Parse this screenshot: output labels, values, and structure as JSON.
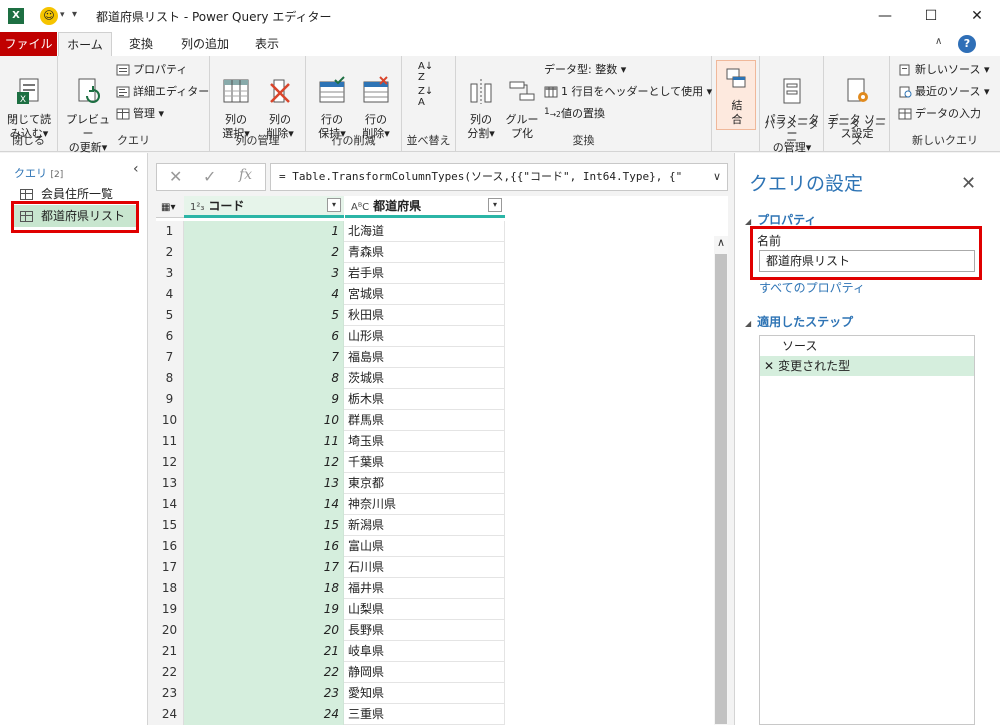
{
  "window": {
    "title": "都道府県リスト - Power Query エディター",
    "app_icon": "X"
  },
  "tabs": [
    "ファイル",
    "ホーム",
    "変換",
    "列の追加",
    "表示"
  ],
  "ribbon": {
    "close_load": "閉じて読\nみ込む",
    "close_group": "閉じる",
    "preview_refresh": "プレビュー\nの更新",
    "properties": "プロパティ",
    "advanced_editor": "詳細エディター",
    "manage": "管理",
    "query_group": "クエリ",
    "choose_columns": "列の\n選択",
    "remove_columns": "列の\n削除",
    "manage_columns_group": "列の管理",
    "keep_rows": "行の\n保持",
    "remove_rows": "行の\n削除",
    "reduce_rows_group": "行の削減",
    "sort_group": "並べ替え",
    "split_column": "列の\n分割",
    "group_by": "グルー\nプ化",
    "data_type": "データ型: 整数",
    "use_first_row": "1 行目をヘッダーとして使用",
    "replace_values": "値の置換",
    "transform_group": "変換",
    "combine": "結\n合",
    "manage_params": "パラメーター\nの管理",
    "params_group": "パラメーター",
    "datasource_settings": "データ ソー\nス設定",
    "datasource_group": "データ ソース",
    "new_source": "新しいソース",
    "recent_sources": "最近のソース",
    "enter_data": "データの入力",
    "new_query_group": "新しいクエリ"
  },
  "queries": {
    "header": "クエリ",
    "count": "[2]",
    "items": [
      "会員住所一覧",
      "都道府県リスト"
    ]
  },
  "formula": {
    "text": "= Table.TransformColumnTypes(ソース,{{\"コード\", Int64.Type}, {\""
  },
  "grid": {
    "col1_type": "1²₃",
    "col1_name": "コード",
    "col2_type": "AᴮC",
    "col2_name": "都道府県",
    "rows": [
      {
        "n": "1",
        "code": "1",
        "pref": "北海道"
      },
      {
        "n": "2",
        "code": "2",
        "pref": "青森県"
      },
      {
        "n": "3",
        "code": "3",
        "pref": "岩手県"
      },
      {
        "n": "4",
        "code": "4",
        "pref": "宮城県"
      },
      {
        "n": "5",
        "code": "5",
        "pref": "秋田県"
      },
      {
        "n": "6",
        "code": "6",
        "pref": "山形県"
      },
      {
        "n": "7",
        "code": "7",
        "pref": "福島県"
      },
      {
        "n": "8",
        "code": "8",
        "pref": "茨城県"
      },
      {
        "n": "9",
        "code": "9",
        "pref": "栃木県"
      },
      {
        "n": "10",
        "code": "10",
        "pref": "群馬県"
      },
      {
        "n": "11",
        "code": "11",
        "pref": "埼玉県"
      },
      {
        "n": "12",
        "code": "12",
        "pref": "千葉県"
      },
      {
        "n": "13",
        "code": "13",
        "pref": "東京都"
      },
      {
        "n": "14",
        "code": "14",
        "pref": "神奈川県"
      },
      {
        "n": "15",
        "code": "15",
        "pref": "新潟県"
      },
      {
        "n": "16",
        "code": "16",
        "pref": "富山県"
      },
      {
        "n": "17",
        "code": "17",
        "pref": "石川県"
      },
      {
        "n": "18",
        "code": "18",
        "pref": "福井県"
      },
      {
        "n": "19",
        "code": "19",
        "pref": "山梨県"
      },
      {
        "n": "20",
        "code": "20",
        "pref": "長野県"
      },
      {
        "n": "21",
        "code": "21",
        "pref": "岐阜県"
      },
      {
        "n": "22",
        "code": "22",
        "pref": "静岡県"
      },
      {
        "n": "23",
        "code": "23",
        "pref": "愛知県"
      },
      {
        "n": "24",
        "code": "24",
        "pref": "三重県"
      }
    ]
  },
  "settings": {
    "title": "クエリの設定",
    "properties_header": "プロパティ",
    "name_label": "名前",
    "name_value": "都道府県リスト",
    "all_properties": "すべてのプロパティ",
    "applied_steps_header": "適用したステップ",
    "steps": [
      "ソース",
      "変更された型"
    ]
  }
}
